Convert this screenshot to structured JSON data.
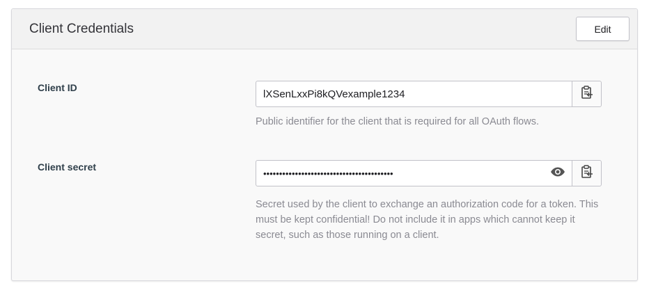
{
  "panel": {
    "title": "Client Credentials",
    "edit_label": "Edit"
  },
  "client_id": {
    "label": "Client ID",
    "value": "lXSenLxxPi8kQVexample1234",
    "help": "Public identifier for the client that is required for all OAuth flows.",
    "copy_icon": "clipboard-icon"
  },
  "client_secret": {
    "label": "Client secret",
    "value": "•••••••••••••••••••••••••••••••••••••••••",
    "help": "Secret used by the client to exchange an authorization code for a token. This must be kept confidential! Do not include it in apps which cannot keep it secret, such as those running on a client.",
    "reveal_icon": "eye-icon",
    "copy_icon": "clipboard-icon"
  },
  "colors": {
    "panel_bg": "#f9f9f9",
    "header_bg": "#f2f2f2",
    "label_text": "#2f3f4a",
    "help_text": "#8a8a92"
  }
}
